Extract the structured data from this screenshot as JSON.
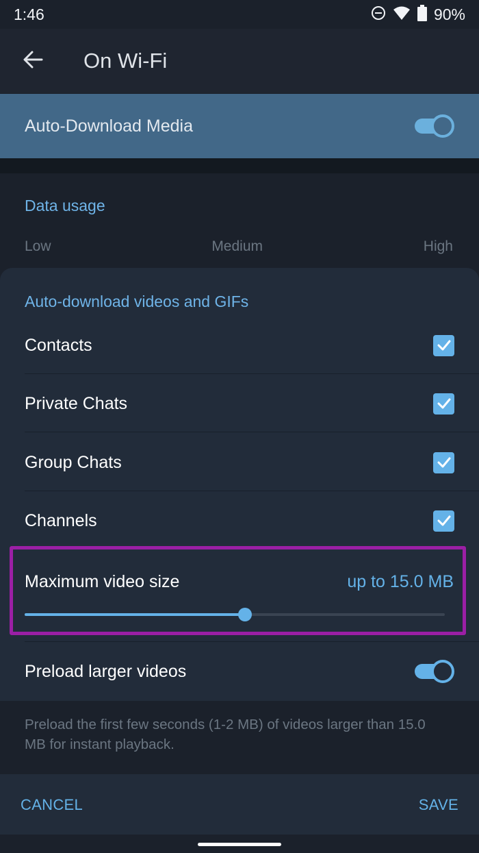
{
  "status_bar": {
    "time": "1:46",
    "battery_percent": "90%",
    "icons": [
      "do-not-disturb-icon",
      "wifi-icon",
      "battery-icon"
    ]
  },
  "app_bar": {
    "title": "On Wi-Fi",
    "back_icon": "arrow-left-icon"
  },
  "master_toggle": {
    "label": "Auto-Download Media",
    "enabled": true
  },
  "data_usage": {
    "header": "Data usage",
    "levels": [
      "Low",
      "Medium",
      "High"
    ]
  },
  "sheet": {
    "header": "Auto-download videos and GIFs",
    "options": [
      {
        "label": "Contacts",
        "checked": true
      },
      {
        "label": "Private Chats",
        "checked": true
      },
      {
        "label": "Group Chats",
        "checked": true
      },
      {
        "label": "Channels",
        "checked": true
      }
    ],
    "max_video_size": {
      "label": "Maximum video size",
      "value_text": "up to 15.0 MB",
      "slider_fraction": 0.525
    },
    "preload": {
      "label": "Preload larger videos",
      "enabled": true,
      "description": "Preload the first few seconds (1-2 MB) of videos larger than 15.0 MB for instant playback."
    },
    "buttons": {
      "cancel": "CANCEL",
      "save": "SAVE"
    }
  },
  "colors": {
    "accent": "#64b2e8",
    "header_row": "#426888",
    "highlight": "#9b1fa5",
    "background": "#1b212b",
    "sheet": "#222c3a"
  }
}
